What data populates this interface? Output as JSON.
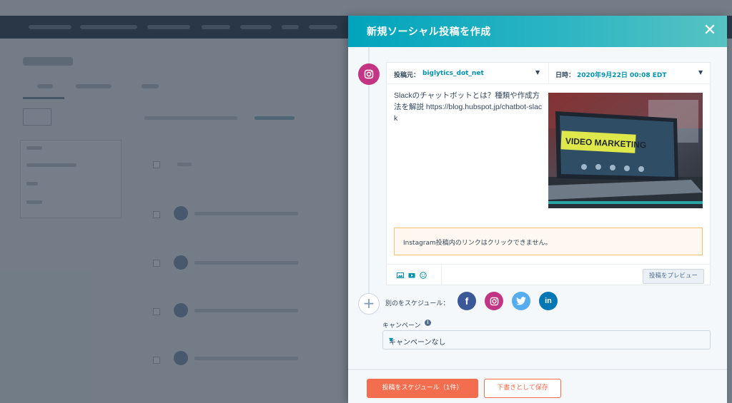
{
  "panel": {
    "title": "新規ソーシャル投稿を作成",
    "close_icon": "close-icon"
  },
  "post": {
    "from_label": "投稿元：",
    "from_account": "biglytics_dot_net",
    "date_label": "日時：",
    "date_value": "2020年9月22日 00:08 EDT",
    "text": "Slackのチャットボットとは？種類や作成方法を解説 https://blog.hubspot.jp/chatbot-slack",
    "image_text": "VIDEO MARKETING",
    "notice": "Instagram投稿内のリンクはクリックできません。",
    "tools": [
      "image-icon",
      "video-icon",
      "emoji-icon"
    ],
    "preview_button": "投稿をプレビュー",
    "network_icon": "instagram-icon"
  },
  "schedule": {
    "label": "別のをスケジュール：",
    "networks": [
      {
        "name": "facebook",
        "glyph": "f",
        "color": "#3b5998"
      },
      {
        "name": "instagram",
        "glyph": "",
        "color": "#c13584"
      },
      {
        "name": "twitter",
        "glyph": "",
        "color": "#55acee"
      },
      {
        "name": "linkedin",
        "glyph": "in",
        "color": "#0077b5"
      }
    ]
  },
  "campaign": {
    "label": "キャンペーン",
    "selected": "キャンペーンなし"
  },
  "footer": {
    "schedule_button": "投稿をスケジュール（1件）",
    "draft_button": "下書きとして保存"
  },
  "colors": {
    "accent": "#00a4bd",
    "primary_button": "#f26e4f",
    "link": "#0091ae"
  }
}
